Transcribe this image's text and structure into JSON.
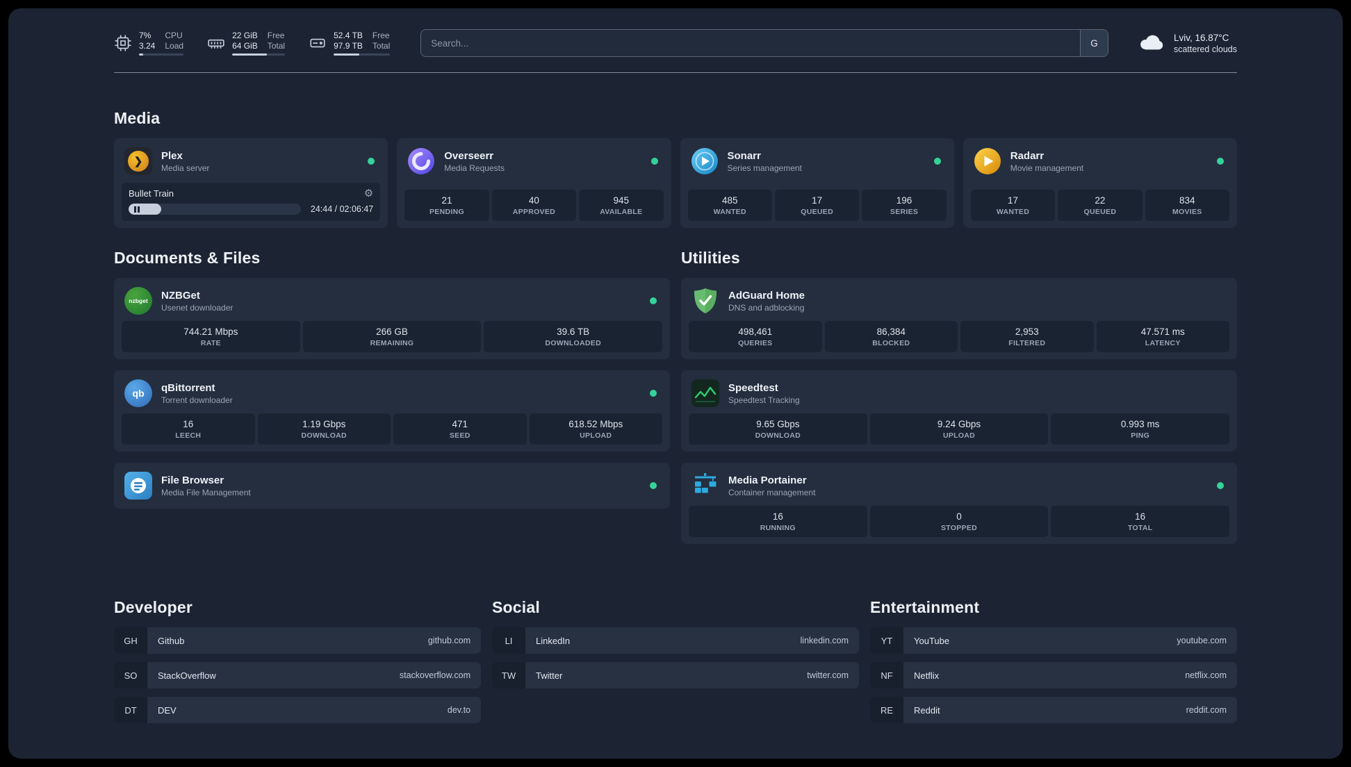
{
  "topbar": {
    "cpu": {
      "value_top": "7%",
      "value_bottom": "3.24",
      "label_top": "CPU",
      "label_bottom": "Load",
      "bar_width": "9%"
    },
    "memory": {
      "value_top": "22 GiB",
      "value_bottom": "64 GiB",
      "label_top": "Free",
      "label_bottom": "Total",
      "bar_width": "66%"
    },
    "disk": {
      "value_top": "52.4 TB",
      "value_bottom": "97.9 TB",
      "label_top": "Free",
      "label_bottom": "Total",
      "bar_width": "46%"
    },
    "search": {
      "placeholder": "Search...",
      "provider_label": "G"
    },
    "weather": {
      "location": "Lviv, 16.87°C",
      "condition": "scattered clouds"
    }
  },
  "icons": {
    "gear": "⚙",
    "plex_chevron": "❯",
    "nzbget_text": "nzbget",
    "qb_text": "qb"
  },
  "colors": {
    "status_online": "#34d399",
    "speedtest_line": "#2fd06f"
  },
  "media": {
    "heading": "Media",
    "plex": {
      "title": "Plex",
      "subtitle": "Media server",
      "track": "Bullet Train",
      "time": "24:44 / 02:06:47",
      "progress_width": "19%"
    },
    "overseerr": {
      "title": "Overseerr",
      "subtitle": "Media Requests",
      "stats": [
        {
          "value": "21",
          "label": "PENDING"
        },
        {
          "value": "40",
          "label": "APPROVED"
        },
        {
          "value": "945",
          "label": "AVAILABLE"
        }
      ]
    },
    "sonarr": {
      "title": "Sonarr",
      "subtitle": "Series management",
      "stats": [
        {
          "value": "485",
          "label": "WANTED"
        },
        {
          "value": "17",
          "label": "QUEUED"
        },
        {
          "value": "196",
          "label": "SERIES"
        }
      ]
    },
    "radarr": {
      "title": "Radarr",
      "subtitle": "Movie management",
      "stats": [
        {
          "value": "17",
          "label": "WANTED"
        },
        {
          "value": "22",
          "label": "QUEUED"
        },
        {
          "value": "834",
          "label": "MOVIES"
        }
      ]
    }
  },
  "documents": {
    "heading": "Documents & Files",
    "nzbget": {
      "title": "NZBGet",
      "subtitle": "Usenet downloader",
      "stats": [
        {
          "value": "744.21 Mbps",
          "label": "RATE"
        },
        {
          "value": "266 GB",
          "label": "REMAINING"
        },
        {
          "value": "39.6 TB",
          "label": "DOWNLOADED"
        }
      ]
    },
    "qbittorrent": {
      "title": "qBittorrent",
      "subtitle": "Torrent downloader",
      "stats": [
        {
          "value": "16",
          "label": "LEECH"
        },
        {
          "value": "1.19 Gbps",
          "label": "DOWNLOAD"
        },
        {
          "value": "471",
          "label": "SEED"
        },
        {
          "value": "618.52 Mbps",
          "label": "UPLOAD"
        }
      ]
    },
    "filebrowser": {
      "title": "File Browser",
      "subtitle": "Media File Management"
    }
  },
  "utilities": {
    "heading": "Utilities",
    "adguard": {
      "title": "AdGuard Home",
      "subtitle": "DNS and adblocking",
      "stats": [
        {
          "value": "498,461",
          "label": "QUERIES"
        },
        {
          "value": "86,384",
          "label": "BLOCKED"
        },
        {
          "value": "2,953",
          "label": "FILTERED"
        },
        {
          "value": "47.571 ms",
          "label": "LATENCY"
        }
      ]
    },
    "speedtest": {
      "title": "Speedtest",
      "subtitle": "Speedtest Tracking",
      "stats": [
        {
          "value": "9.65 Gbps",
          "label": "DOWNLOAD"
        },
        {
          "value": "9.24 Gbps",
          "label": "UPLOAD"
        },
        {
          "value": "0.993 ms",
          "label": "PING"
        }
      ]
    },
    "portainer": {
      "title": "Media Portainer",
      "subtitle": "Container management",
      "stats": [
        {
          "value": "16",
          "label": "RUNNING"
        },
        {
          "value": "0",
          "label": "STOPPED"
        },
        {
          "value": "16",
          "label": "TOTAL"
        }
      ]
    }
  },
  "bookmarks": {
    "developer": {
      "heading": "Developer",
      "items": [
        {
          "abbr": "GH",
          "name": "Github",
          "url": "github.com"
        },
        {
          "abbr": "SO",
          "name": "StackOverflow",
          "url": "stackoverflow.com"
        },
        {
          "abbr": "DT",
          "name": "DEV",
          "url": "dev.to"
        }
      ]
    },
    "social": {
      "heading": "Social",
      "items": [
        {
          "abbr": "LI",
          "name": "LinkedIn",
          "url": "linkedin.com"
        },
        {
          "abbr": "TW",
          "name": "Twitter",
          "url": "twitter.com"
        }
      ]
    },
    "entertainment": {
      "heading": "Entertainment",
      "items": [
        {
          "abbr": "YT",
          "name": "YouTube",
          "url": "youtube.com"
        },
        {
          "abbr": "NF",
          "name": "Netflix",
          "url": "netflix.com"
        },
        {
          "abbr": "RE",
          "name": "Reddit",
          "url": "reddit.com"
        }
      ]
    }
  }
}
